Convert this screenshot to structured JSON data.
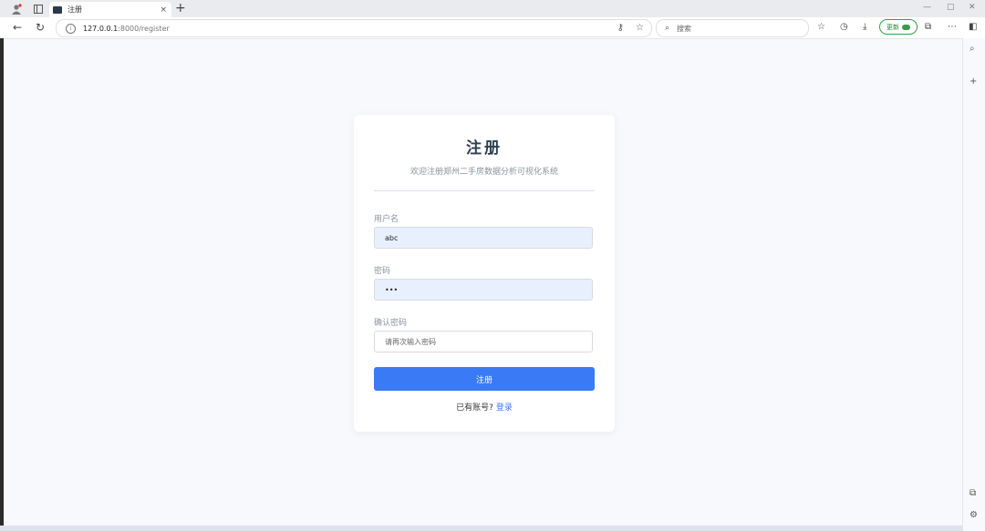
{
  "browser": {
    "tab_title": "注册",
    "tab_close": "×",
    "new_tab": "+",
    "url_host": "127.0.0.1",
    "url_path": ":8000/register",
    "search_placeholder": "搜索",
    "update_label": "更新",
    "window_min": "—",
    "window_restore": "▢"
  },
  "page": {
    "title": "注册",
    "subtitle": "欢迎注册郑州二手房数据分析可视化系统",
    "username_label": "用户名",
    "username_value": "abc",
    "password_label": "密码",
    "password_value": "•••",
    "confirm_label": "确认密码",
    "confirm_placeholder": "请再次输入密码",
    "submit_label": "注册",
    "footer_text": "已有账号?",
    "login_link": "登录"
  }
}
